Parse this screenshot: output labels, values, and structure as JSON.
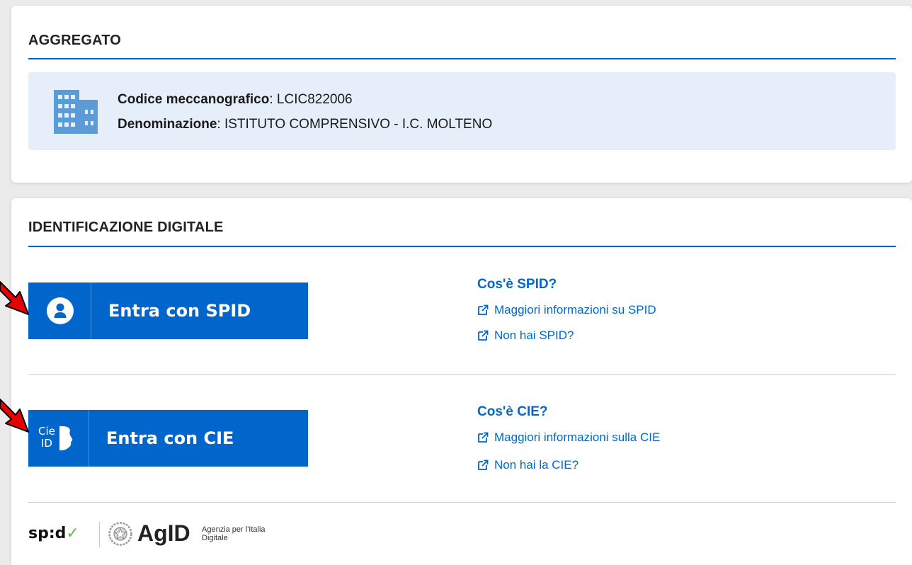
{
  "aggregato": {
    "title": "AGGREGATO",
    "codice_label": "Codice meccanografico",
    "codice_value": "LCIC822006",
    "denominazione_label": "Denominazione",
    "denominazione_value": "ISTITUTO COMPRENSIVO - I.C. MOLTENO"
  },
  "identificazione": {
    "title": "IDENTIFICAZIONE DIGITALE",
    "spid": {
      "button_label": "Entra con SPID",
      "info_title": "Cos'è SPID?",
      "link_more": "Maggiori informazioni su SPID",
      "link_none": "Non hai SPID?"
    },
    "cie": {
      "button_label": "Entra con CIE",
      "icon_text_top": "Cie",
      "icon_text_bottom": "ID",
      "info_title": "Cos'è CIE?",
      "link_more": "Maggiori informazioni sulla CIE",
      "link_none": "Non hai la CIE?"
    }
  },
  "footer": {
    "spid_logo_text": "sp:d",
    "spid_logo_check": "✓",
    "agid_text": "AgID",
    "agid_subtitle": "Agenzia per l'Italia Digitale"
  },
  "colors": {
    "primary": "#0066cc",
    "info_box_bg": "#e6eff9",
    "annotation_arrow": "#e60000"
  }
}
